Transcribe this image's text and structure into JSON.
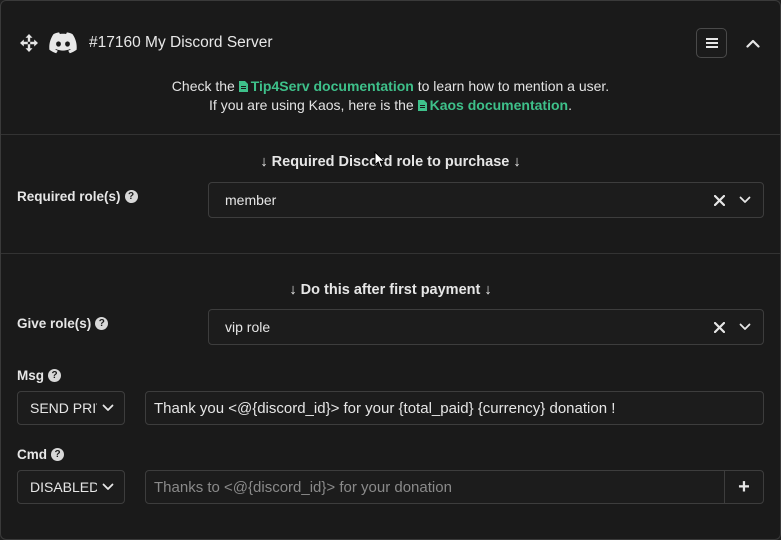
{
  "header": {
    "server_title": "#17160 My Discord Server",
    "doc_line1_prefix": "Check the",
    "doc_line1_link": "Tip4Serv documentation",
    "doc_line1_suffix": "to learn how to mention a user.",
    "doc_line2_prefix": "If you are using Kaos, here is the",
    "doc_line2_link": "Kaos documentation",
    "doc_line2_suffix": ".",
    "accent_color": "#3ec08a"
  },
  "required_section": {
    "heading": "↓ Required Discord role to purchase ↓",
    "label": "Required role(s)",
    "help": "?",
    "selected_value": "member"
  },
  "payment_section": {
    "heading": "↓ Do this after first payment ↓",
    "give_role": {
      "label": "Give role(s)",
      "help": "?",
      "selected_value": "vip role"
    },
    "msg": {
      "label": "Msg",
      "help": "?",
      "mode_value": "SEND PRIV",
      "text_value": "Thank you <@{discord_id}> for your {total_paid} {currency} donation !"
    },
    "cmd": {
      "label": "Cmd",
      "help": "?",
      "mode_value": "DISABLED",
      "placeholder": "Thanks to <@{discord_id}> for your donation",
      "add_symbol": "+"
    }
  },
  "icons": {
    "move": "move-arrows-icon",
    "discord": "discord-logo-icon",
    "menu": "hamburger-menu-icon",
    "collapse": "chevron-up-icon",
    "clear": "close-x-icon",
    "dropdown": "chevron-down-icon",
    "file": "file-text-icon"
  }
}
